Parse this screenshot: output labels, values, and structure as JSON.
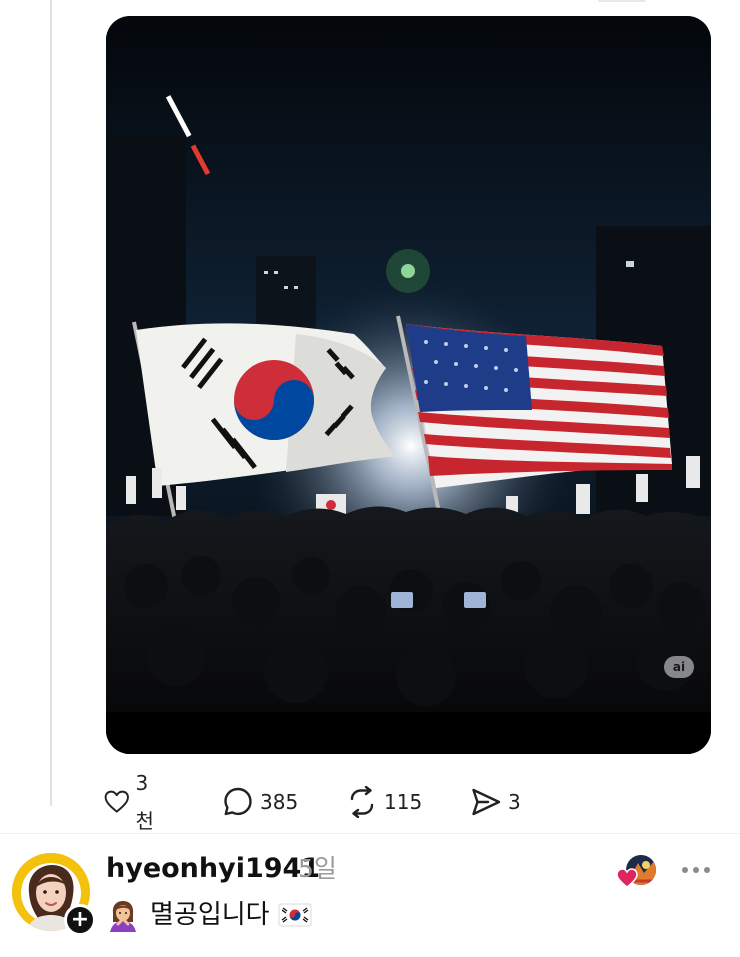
{
  "post": {
    "media_badge": "ai",
    "actions": {
      "like_count": "3천",
      "comment_count": "385",
      "repost_count": "115",
      "share_count": "3"
    }
  },
  "reply": {
    "username": "hyeonhyi1941",
    "timestamp": "5일",
    "follow_symbol": "+",
    "text": "멸공입니다"
  },
  "icons": {
    "like": "heart-icon",
    "comment": "comment-icon",
    "repost": "repost-icon",
    "share": "send-icon",
    "more": "more-icon",
    "follow": "plus-icon"
  },
  "colors": {
    "flag_red": "#cd2e3a",
    "flag_blue": "#0047a0",
    "us_blue": "#1f3c88",
    "heart_red": "#e0245e",
    "avatar_bg": "#f4c20d",
    "muted_text": "#9a9a9a"
  }
}
